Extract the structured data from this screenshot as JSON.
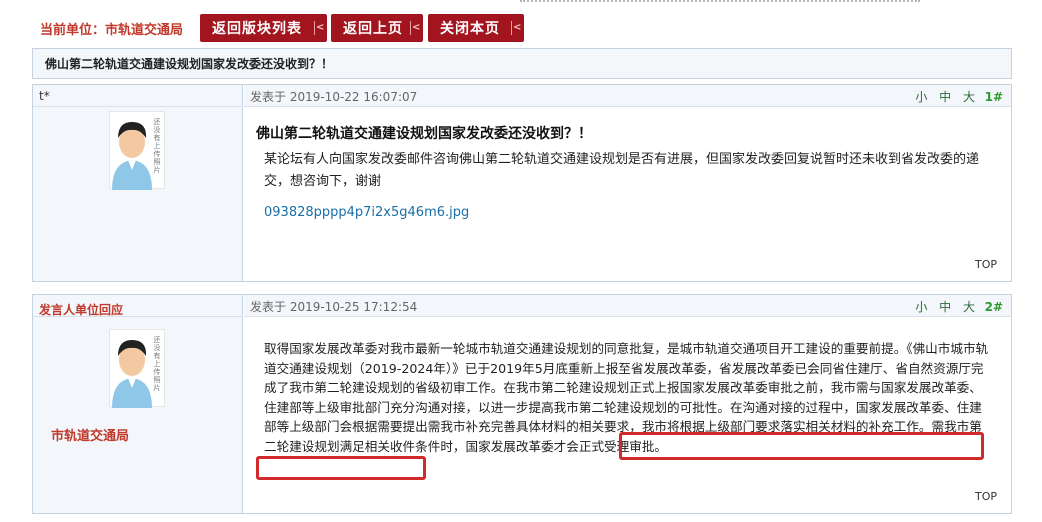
{
  "breadcrumb": {
    "label": "当前单位：市轨道交通局"
  },
  "toolbar": {
    "back_to_list": "返回版块列表",
    "back_prev": "返回上页",
    "close_page": "关闭本页",
    "chevron": "<"
  },
  "thread": {
    "title": "佛山第二轮轨道交通建设规划国家发改委还没收到？！"
  },
  "posts": [
    {
      "author": "t*",
      "posted_at": "发表于 2019-10-22 16:07:07",
      "font_controls": "小 中 大",
      "floor": "1#",
      "heading": "佛山第二轮轨道交通建设规划国家发改委还没收到？！",
      "body": "某论坛有人向国家发改委邮件咨询佛山第二轮轨道交通建设规划是否有进展，但国家发改委回复说暂时还未收到省发改委的递交，想咨询下，谢谢",
      "attachment": "093828pppp4p7i2x5g46m6.jpg",
      "top": "TOP"
    },
    {
      "author": "发言人单位回应",
      "author_unit": "市轨道交通局",
      "posted_at": "发表于 2019-10-25 17:12:54",
      "font_controls": "小 中 大",
      "floor": "2#",
      "body_part1": "取得国家发展改革委对我市最新一轮城市轨道交通建设规划的同意批复，是城市轨道交通项目开工建设的重要前提。《佛山市城市轨道交通建设规划（2019-2024年）》已于2019年5月底重新上报至省发展改革委，省发展改革委已会同省住建厅、省自然资源厅完成了我市第二轮建设规划的省级初审工作。在我市第二轮建设规划正式上报国家发展改革委审批之前，我市需与国家发展改革委、住建部等上级审批部门充分沟通对接，以进一步提高我市第二轮建设规划的可批性。在沟通对接的过程中，国家发展改革委、住建部等上级部门会根据需要提出需我市补充完善具体材料的相关要求，我市将根据上级部门要求落实相关材料的补充工作。",
      "body_part2": "需我市第二轮建设规划满足相关收件条件时，国家发展改革委才会正式受理审批。",
      "top": "TOP"
    }
  ],
  "avatar_caption": "还没有上传照片",
  "colors": {
    "accent_red": "#a3151e",
    "link_blue": "#1a6fa8",
    "highlight": "#d22a2a",
    "floor_green": "#2d9a2d"
  }
}
